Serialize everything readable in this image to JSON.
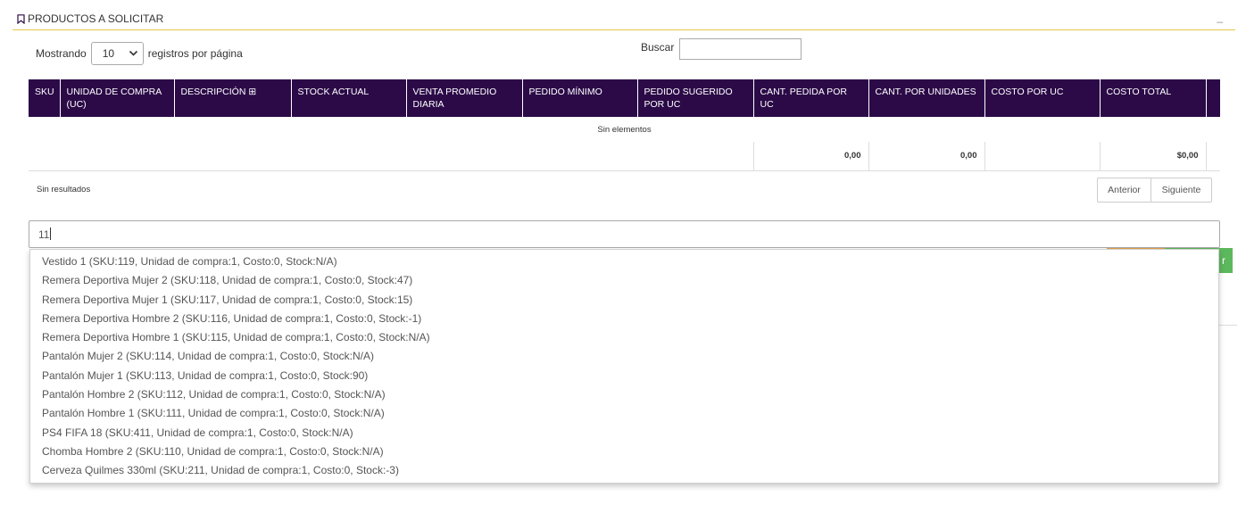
{
  "panel": {
    "title": "PRODUCTOS A SOLICITAR",
    "collapse_symbol": "_"
  },
  "length": {
    "prefix": "Mostrando",
    "value": "10",
    "suffix": "registros por página"
  },
  "search": {
    "label": "Buscar",
    "value": ""
  },
  "table": {
    "headers": [
      "SKU",
      "UNIDAD DE COMPRA (UC)",
      "DESCRIPCIÓN ⊞",
      "STOCK ACTUAL",
      "VENTA PROMEDIO DIARIA",
      "PEDIDO MÍNIMO",
      "PEDIDO SUGERIDO POR UC",
      "CANT. PEDIDA POR UC",
      "CANT. POR UNIDADES",
      "COSTO POR UC",
      "COSTO TOTAL"
    ],
    "empty_text": "Sin elementos",
    "totals": {
      "cant_pedida": "0,00",
      "cant_unidades": "0,00",
      "costo_total": "$0,00"
    }
  },
  "info": "Sin resultados",
  "pager": {
    "prev": "Anterior",
    "next": "Siguiente"
  },
  "green_button": {
    "label": "r"
  },
  "product_search": {
    "value": "11"
  },
  "suggestions": [
    "Vestido 1 (SKU:119, Unidad de compra:1, Costo:0, Stock:N/A)",
    "Remera Deportiva Mujer 2 (SKU:118, Unidad de compra:1, Costo:0, Stock:47)",
    "Remera Deportiva Mujer 1 (SKU:117, Unidad de compra:1, Costo:0, Stock:15)",
    "Remera Deportiva Hombre 2 (SKU:116, Unidad de compra:1, Costo:0, Stock:-1)",
    "Remera Deportiva Hombre 1 (SKU:115, Unidad de compra:1, Costo:0, Stock:N/A)",
    "Pantalón Mujer 2 (SKU:114, Unidad de compra:1, Costo:0, Stock:N/A)",
    "Pantalón Mujer 1 (SKU:113, Unidad de compra:1, Costo:0, Stock:90)",
    "Pantalón Hombre 2 (SKU:112, Unidad de compra:1, Costo:0, Stock:N/A)",
    "Pantalón Hombre 1 (SKU:111, Unidad de compra:1, Costo:0, Stock:N/A)",
    "PS4 FIFA 18 (SKU:411, Unidad de compra:1, Costo:0, Stock:N/A)",
    "Chomba Hombre 2 (SKU:110, Unidad de compra:1, Costo:0, Stock:N/A)",
    "Cerveza Quilmes 330ml (SKU:211, Unidad de compra:1, Costo:0, Stock:-3)"
  ],
  "colors": {
    "header_bg": "#2b0a47",
    "accent_line": "#e8c64a",
    "green": "#5cb85c"
  }
}
